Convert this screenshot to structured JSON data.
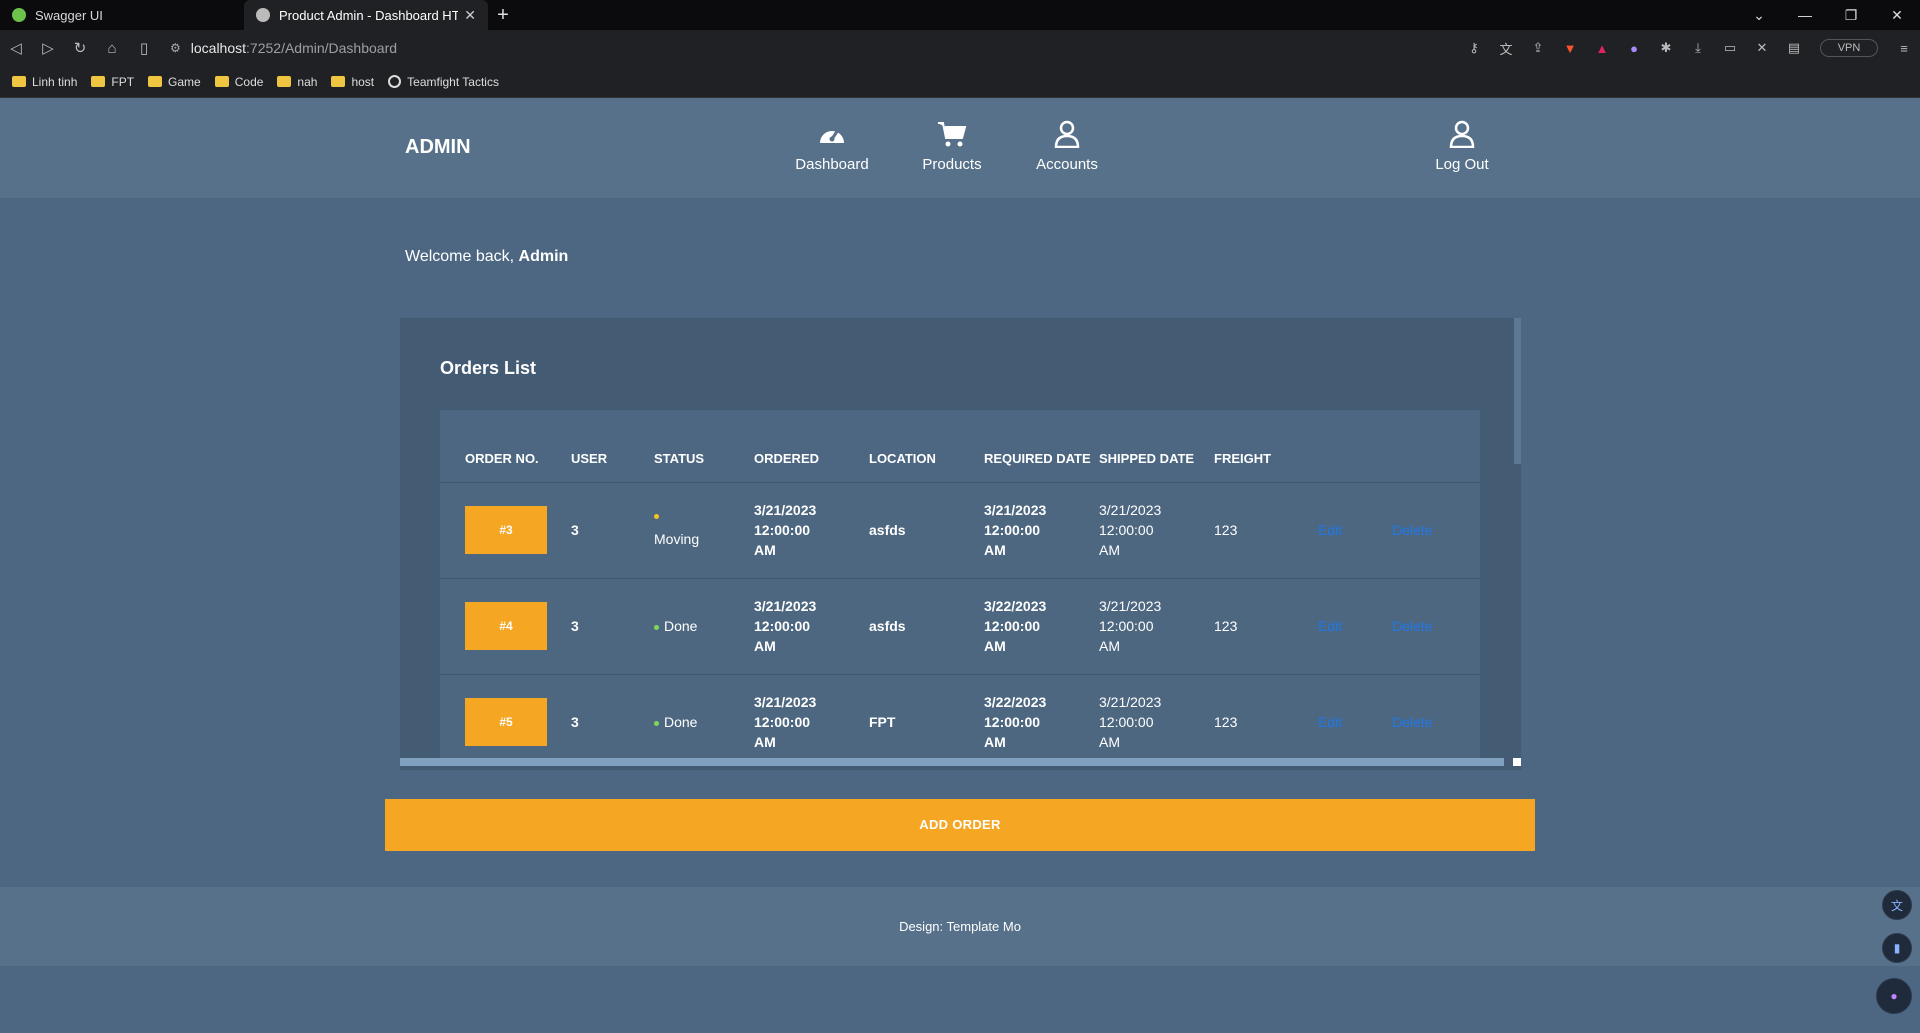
{
  "browser": {
    "tabs": [
      {
        "title": "Swagger UI",
        "active": false,
        "favicon_color": "#6cc24a"
      },
      {
        "title": "Product Admin - Dashboard HTML",
        "active": true,
        "favicon_color": "#bbbbbb"
      }
    ],
    "new_tab": "+",
    "url_host": "localhost",
    "url_path": ":7252/Admin/Dashboard",
    "vpn_label": "VPN",
    "bookmarks": [
      {
        "label": "Linh tinh",
        "type": "folder"
      },
      {
        "label": "FPT",
        "type": "folder"
      },
      {
        "label": "Game",
        "type": "folder"
      },
      {
        "label": "Code",
        "type": "folder"
      },
      {
        "label": "nah",
        "type": "folder"
      },
      {
        "label": "host",
        "type": "folder"
      },
      {
        "label": "Teamfight Tactics",
        "type": "site"
      }
    ]
  },
  "header": {
    "brand": "ADMIN",
    "nav": [
      {
        "label": "Dashboard",
        "icon": "speedometer-icon"
      },
      {
        "label": "Products",
        "icon": "cart-icon"
      },
      {
        "label": "Accounts",
        "icon": "user-icon"
      }
    ],
    "logout": {
      "label": "Log Out",
      "icon": "user-icon"
    }
  },
  "welcome": {
    "prefix": "Welcome back, ",
    "name": "Admin"
  },
  "orders": {
    "title": "Orders List",
    "columns": [
      "ORDER NO.",
      "USER",
      "STATUS",
      "ORDERED",
      "LOCATION",
      "REQUIRED DATE",
      "SHIPPED DATE",
      "FREIGHT"
    ],
    "rows": [
      {
        "order_no": "#3",
        "user": "3",
        "status": "Moving",
        "status_color": "#f5c518",
        "ordered": [
          "3/21/2023",
          "12:00:00",
          "AM"
        ],
        "location": "asfds",
        "required": [
          "3/21/2023",
          "12:00:00",
          "AM"
        ],
        "shipped": [
          "3/21/2023",
          "12:00:00",
          "AM"
        ],
        "freight": "123",
        "edit": "Edit",
        "delete": "Delete"
      },
      {
        "order_no": "#4",
        "user": "3",
        "status": "Done",
        "status_color": "#7ed957",
        "ordered": [
          "3/21/2023",
          "12:00:00",
          "AM"
        ],
        "location": "asfds",
        "required": [
          "3/22/2023",
          "12:00:00",
          "AM"
        ],
        "shipped": [
          "3/21/2023",
          "12:00:00",
          "AM"
        ],
        "freight": "123",
        "edit": "Edit",
        "delete": "Delete"
      },
      {
        "order_no": "#5",
        "user": "3",
        "status": "Done",
        "status_color": "#7ed957",
        "ordered": [
          "3/21/2023",
          "12:00:00",
          "AM"
        ],
        "location": "FPT",
        "required": [
          "3/22/2023",
          "12:00:00",
          "AM"
        ],
        "shipped": [
          "3/21/2023",
          "12:00:00",
          "AM"
        ],
        "freight": "123",
        "edit": "Edit",
        "delete": "Delete"
      }
    ]
  },
  "add_order_label": "ADD ORDER",
  "footer_text": "Design: Template Mo",
  "colors": {
    "accent": "#f5a623",
    "link": "#1e78e6",
    "background": "#4d6782"
  }
}
